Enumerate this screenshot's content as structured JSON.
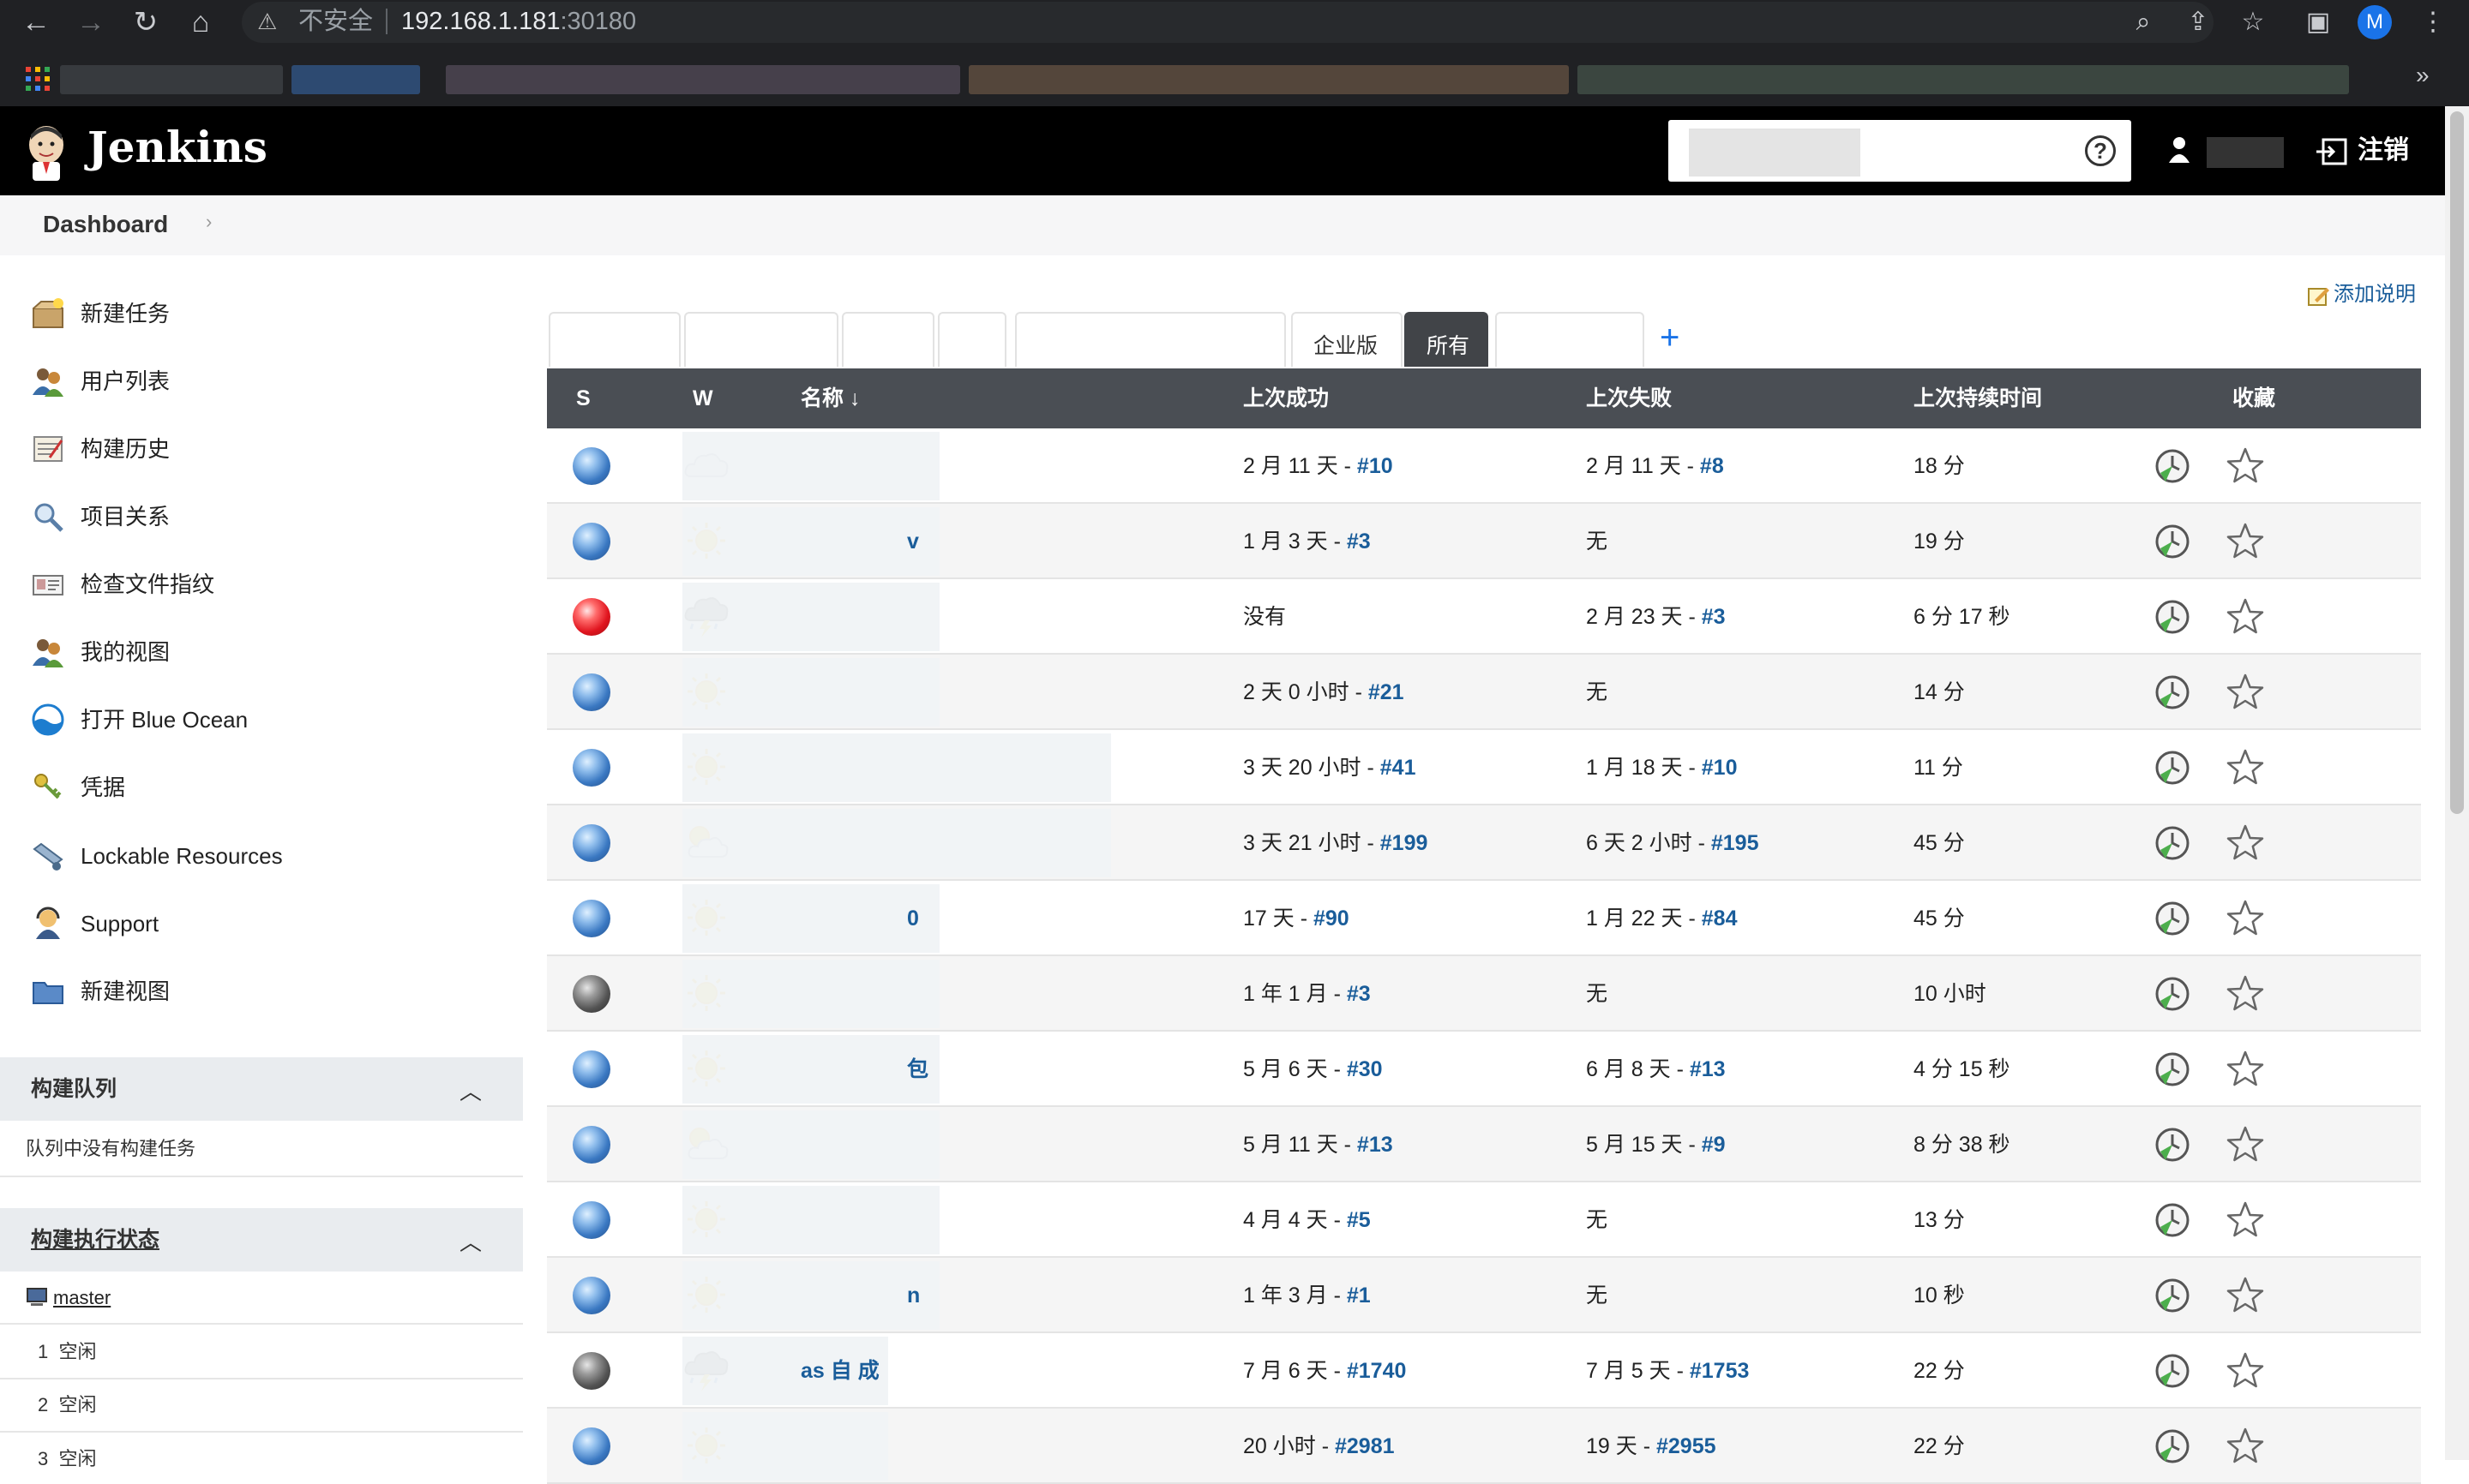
{
  "browser": {
    "security_label": "不安全",
    "url_host": "192.168.1.181",
    "url_port": ":30180",
    "profile_initial": "M",
    "bookmarks_more": "»"
  },
  "header": {
    "title": "Jenkins",
    "search_placeholder": "",
    "help": "?",
    "logout_label": "注销"
  },
  "breadcrumb": {
    "dashboard": "Dashboard",
    "chevron": "›"
  },
  "sidebar": {
    "items": [
      {
        "label": "新建任务",
        "icon": "new-item-icon"
      },
      {
        "label": "用户列表",
        "icon": "users-icon"
      },
      {
        "label": "构建历史",
        "icon": "build-history-icon"
      },
      {
        "label": "项目关系",
        "icon": "search-icon"
      },
      {
        "label": "检查文件指纹",
        "icon": "fingerprint-icon"
      },
      {
        "label": "我的视图",
        "icon": "my-views-icon"
      },
      {
        "label": "打开 Blue Ocean",
        "icon": "blue-ocean-icon"
      },
      {
        "label": "凭据",
        "icon": "credentials-icon"
      },
      {
        "label": "Lockable Resources",
        "icon": "lockable-resources-icon"
      },
      {
        "label": "Support",
        "icon": "support-icon"
      },
      {
        "label": "新建视图",
        "icon": "folder-icon"
      }
    ],
    "build_queue": {
      "title": "构建队列",
      "empty": "队列中没有构建任务"
    },
    "executors": {
      "title": "构建执行状态",
      "node": "master",
      "slots": [
        {
          "num": "1",
          "status": "空闲"
        },
        {
          "num": "2",
          "status": "空闲"
        },
        {
          "num": "3",
          "status": "空闲"
        }
      ]
    }
  },
  "main": {
    "add_description": "添加说明",
    "tabs": [
      {
        "label": ""
      },
      {
        "label": ""
      },
      {
        "label": ""
      },
      {
        "label": ""
      },
      {
        "label": ""
      },
      {
        "label": "企业版"
      },
      {
        "label": "所有"
      },
      {
        "label": ""
      }
    ],
    "add_tab": "+",
    "table": {
      "headers": {
        "s": "S",
        "w": "W",
        "name": "名称 ↓",
        "last_success": "上次成功",
        "last_failure": "上次失败",
        "last_duration": "上次持续时间",
        "favorite": "收藏"
      },
      "rows": [
        {
          "status": "blue",
          "weather": "cloudy",
          "name": "",
          "succ_text": "2 月 11 天 - ",
          "succ_link": "#10",
          "fail_text": "2 月 11 天 - ",
          "fail_link": "#8",
          "duration": "18 分"
        },
        {
          "status": "blue",
          "weather": "sunny",
          "name": "v",
          "succ_text": "1 月 3 天 - ",
          "succ_link": "#3",
          "fail_text": "无",
          "fail_link": "",
          "duration": "19 分"
        },
        {
          "status": "red",
          "weather": "storm",
          "name": "",
          "succ_text": "没有",
          "succ_link": "",
          "fail_text": "2 月 23 天 - ",
          "fail_link": "#3",
          "duration": "6 分 17 秒"
        },
        {
          "status": "blue",
          "weather": "sunny",
          "name": "",
          "succ_text": "2 天 0 小时 - ",
          "succ_link": "#21",
          "fail_text": "无",
          "fail_link": "",
          "duration": "14 分"
        },
        {
          "status": "blue",
          "weather": "sunny",
          "name": "",
          "succ_text": "3 天 20 小时 - ",
          "succ_link": "#41",
          "fail_text": "1 月 18 天 - ",
          "fail_link": "#10",
          "duration": "11 分"
        },
        {
          "status": "blue",
          "weather": "partly-cloudy",
          "name": "",
          "succ_text": "3 天 21 小时 - ",
          "succ_link": "#199",
          "fail_text": "6 天 2 小时 - ",
          "fail_link": "#195",
          "duration": "45 分"
        },
        {
          "status": "blue",
          "weather": "sunny",
          "name": "0",
          "succ_text": "17 天 - ",
          "succ_link": "#90",
          "fail_text": "1 月 22 天 - ",
          "fail_link": "#84",
          "duration": "45 分"
        },
        {
          "status": "grey",
          "weather": "sunny",
          "name": "",
          "succ_text": "1 年 1 月 - ",
          "succ_link": "#3",
          "fail_text": "无",
          "fail_link": "",
          "duration": "10 小时"
        },
        {
          "status": "blue",
          "weather": "sunny",
          "name": "包",
          "succ_text": "5 月 6 天 - ",
          "succ_link": "#30",
          "fail_text": "6 月 8 天 - ",
          "fail_link": "#13",
          "duration": "4 分 15 秒"
        },
        {
          "status": "blue",
          "weather": "partly-cloudy",
          "name": "",
          "succ_text": "5 月 11 天 - ",
          "succ_link": "#13",
          "fail_text": "5 月 15 天 - ",
          "fail_link": "#9",
          "duration": "8 分 38 秒"
        },
        {
          "status": "blue",
          "weather": "sunny",
          "name": "",
          "succ_text": "4 月 4 天 - ",
          "succ_link": "#5",
          "fail_text": "无",
          "fail_link": "",
          "duration": "13 分"
        },
        {
          "status": "blue",
          "weather": "sunny",
          "name": "n",
          "succ_text": "1 年 3 月 - ",
          "succ_link": "#1",
          "fail_text": "无",
          "fail_link": "",
          "duration": "10 秒"
        },
        {
          "status": "grey",
          "weather": "storm",
          "name": "as 自 成",
          "succ_text": "7 月 6 天 - ",
          "succ_link": "#1740",
          "fail_text": "7 月 5 天 - ",
          "fail_link": "#1753",
          "duration": "22 分"
        },
        {
          "status": "blue",
          "weather": "sunny",
          "name": "",
          "succ_text": "20 小时 - ",
          "succ_link": "#2981",
          "fail_text": "19 天 - ",
          "fail_link": "#2955",
          "duration": "22 分"
        }
      ]
    }
  },
  "colors": {
    "header_bg": "#000000",
    "table_head_bg": "#4a4e54",
    "link": "#1a5d9a",
    "active_tab": "#414448"
  }
}
